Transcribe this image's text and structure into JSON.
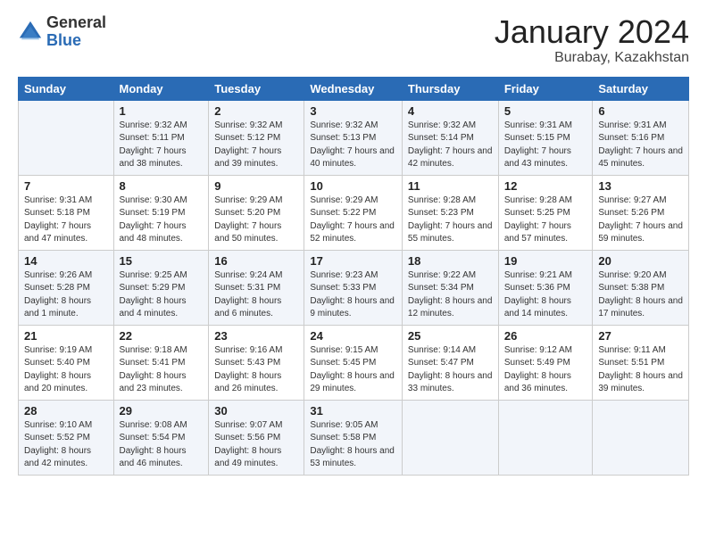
{
  "logo": {
    "general": "General",
    "blue": "Blue"
  },
  "title": "January 2024",
  "location": "Burabay, Kazakhstan",
  "weekdays": [
    "Sunday",
    "Monday",
    "Tuesday",
    "Wednesday",
    "Thursday",
    "Friday",
    "Saturday"
  ],
  "weeks": [
    [
      {
        "day": "",
        "sunrise": "",
        "sunset": "",
        "daylight": ""
      },
      {
        "day": "1",
        "sunrise": "Sunrise: 9:32 AM",
        "sunset": "Sunset: 5:11 PM",
        "daylight": "Daylight: 7 hours and 38 minutes."
      },
      {
        "day": "2",
        "sunrise": "Sunrise: 9:32 AM",
        "sunset": "Sunset: 5:12 PM",
        "daylight": "Daylight: 7 hours and 39 minutes."
      },
      {
        "day": "3",
        "sunrise": "Sunrise: 9:32 AM",
        "sunset": "Sunset: 5:13 PM",
        "daylight": "Daylight: 7 hours and 40 minutes."
      },
      {
        "day": "4",
        "sunrise": "Sunrise: 9:32 AM",
        "sunset": "Sunset: 5:14 PM",
        "daylight": "Daylight: 7 hours and 42 minutes."
      },
      {
        "day": "5",
        "sunrise": "Sunrise: 9:31 AM",
        "sunset": "Sunset: 5:15 PM",
        "daylight": "Daylight: 7 hours and 43 minutes."
      },
      {
        "day": "6",
        "sunrise": "Sunrise: 9:31 AM",
        "sunset": "Sunset: 5:16 PM",
        "daylight": "Daylight: 7 hours and 45 minutes."
      }
    ],
    [
      {
        "day": "7",
        "sunrise": "Sunrise: 9:31 AM",
        "sunset": "Sunset: 5:18 PM",
        "daylight": "Daylight: 7 hours and 47 minutes."
      },
      {
        "day": "8",
        "sunrise": "Sunrise: 9:30 AM",
        "sunset": "Sunset: 5:19 PM",
        "daylight": "Daylight: 7 hours and 48 minutes."
      },
      {
        "day": "9",
        "sunrise": "Sunrise: 9:29 AM",
        "sunset": "Sunset: 5:20 PM",
        "daylight": "Daylight: 7 hours and 50 minutes."
      },
      {
        "day": "10",
        "sunrise": "Sunrise: 9:29 AM",
        "sunset": "Sunset: 5:22 PM",
        "daylight": "Daylight: 7 hours and 52 minutes."
      },
      {
        "day": "11",
        "sunrise": "Sunrise: 9:28 AM",
        "sunset": "Sunset: 5:23 PM",
        "daylight": "Daylight: 7 hours and 55 minutes."
      },
      {
        "day": "12",
        "sunrise": "Sunrise: 9:28 AM",
        "sunset": "Sunset: 5:25 PM",
        "daylight": "Daylight: 7 hours and 57 minutes."
      },
      {
        "day": "13",
        "sunrise": "Sunrise: 9:27 AM",
        "sunset": "Sunset: 5:26 PM",
        "daylight": "Daylight: 7 hours and 59 minutes."
      }
    ],
    [
      {
        "day": "14",
        "sunrise": "Sunrise: 9:26 AM",
        "sunset": "Sunset: 5:28 PM",
        "daylight": "Daylight: 8 hours and 1 minute."
      },
      {
        "day": "15",
        "sunrise": "Sunrise: 9:25 AM",
        "sunset": "Sunset: 5:29 PM",
        "daylight": "Daylight: 8 hours and 4 minutes."
      },
      {
        "day": "16",
        "sunrise": "Sunrise: 9:24 AM",
        "sunset": "Sunset: 5:31 PM",
        "daylight": "Daylight: 8 hours and 6 minutes."
      },
      {
        "day": "17",
        "sunrise": "Sunrise: 9:23 AM",
        "sunset": "Sunset: 5:33 PM",
        "daylight": "Daylight: 8 hours and 9 minutes."
      },
      {
        "day": "18",
        "sunrise": "Sunrise: 9:22 AM",
        "sunset": "Sunset: 5:34 PM",
        "daylight": "Daylight: 8 hours and 12 minutes."
      },
      {
        "day": "19",
        "sunrise": "Sunrise: 9:21 AM",
        "sunset": "Sunset: 5:36 PM",
        "daylight": "Daylight: 8 hours and 14 minutes."
      },
      {
        "day": "20",
        "sunrise": "Sunrise: 9:20 AM",
        "sunset": "Sunset: 5:38 PM",
        "daylight": "Daylight: 8 hours and 17 minutes."
      }
    ],
    [
      {
        "day": "21",
        "sunrise": "Sunrise: 9:19 AM",
        "sunset": "Sunset: 5:40 PM",
        "daylight": "Daylight: 8 hours and 20 minutes."
      },
      {
        "day": "22",
        "sunrise": "Sunrise: 9:18 AM",
        "sunset": "Sunset: 5:41 PM",
        "daylight": "Daylight: 8 hours and 23 minutes."
      },
      {
        "day": "23",
        "sunrise": "Sunrise: 9:16 AM",
        "sunset": "Sunset: 5:43 PM",
        "daylight": "Daylight: 8 hours and 26 minutes."
      },
      {
        "day": "24",
        "sunrise": "Sunrise: 9:15 AM",
        "sunset": "Sunset: 5:45 PM",
        "daylight": "Daylight: 8 hours and 29 minutes."
      },
      {
        "day": "25",
        "sunrise": "Sunrise: 9:14 AM",
        "sunset": "Sunset: 5:47 PM",
        "daylight": "Daylight: 8 hours and 33 minutes."
      },
      {
        "day": "26",
        "sunrise": "Sunrise: 9:12 AM",
        "sunset": "Sunset: 5:49 PM",
        "daylight": "Daylight: 8 hours and 36 minutes."
      },
      {
        "day": "27",
        "sunrise": "Sunrise: 9:11 AM",
        "sunset": "Sunset: 5:51 PM",
        "daylight": "Daylight: 8 hours and 39 minutes."
      }
    ],
    [
      {
        "day": "28",
        "sunrise": "Sunrise: 9:10 AM",
        "sunset": "Sunset: 5:52 PM",
        "daylight": "Daylight: 8 hours and 42 minutes."
      },
      {
        "day": "29",
        "sunrise": "Sunrise: 9:08 AM",
        "sunset": "Sunset: 5:54 PM",
        "daylight": "Daylight: 8 hours and 46 minutes."
      },
      {
        "day": "30",
        "sunrise": "Sunrise: 9:07 AM",
        "sunset": "Sunset: 5:56 PM",
        "daylight": "Daylight: 8 hours and 49 minutes."
      },
      {
        "day": "31",
        "sunrise": "Sunrise: 9:05 AM",
        "sunset": "Sunset: 5:58 PM",
        "daylight": "Daylight: 8 hours and 53 minutes."
      },
      {
        "day": "",
        "sunrise": "",
        "sunset": "",
        "daylight": ""
      },
      {
        "day": "",
        "sunrise": "",
        "sunset": "",
        "daylight": ""
      },
      {
        "day": "",
        "sunrise": "",
        "sunset": "",
        "daylight": ""
      }
    ]
  ]
}
